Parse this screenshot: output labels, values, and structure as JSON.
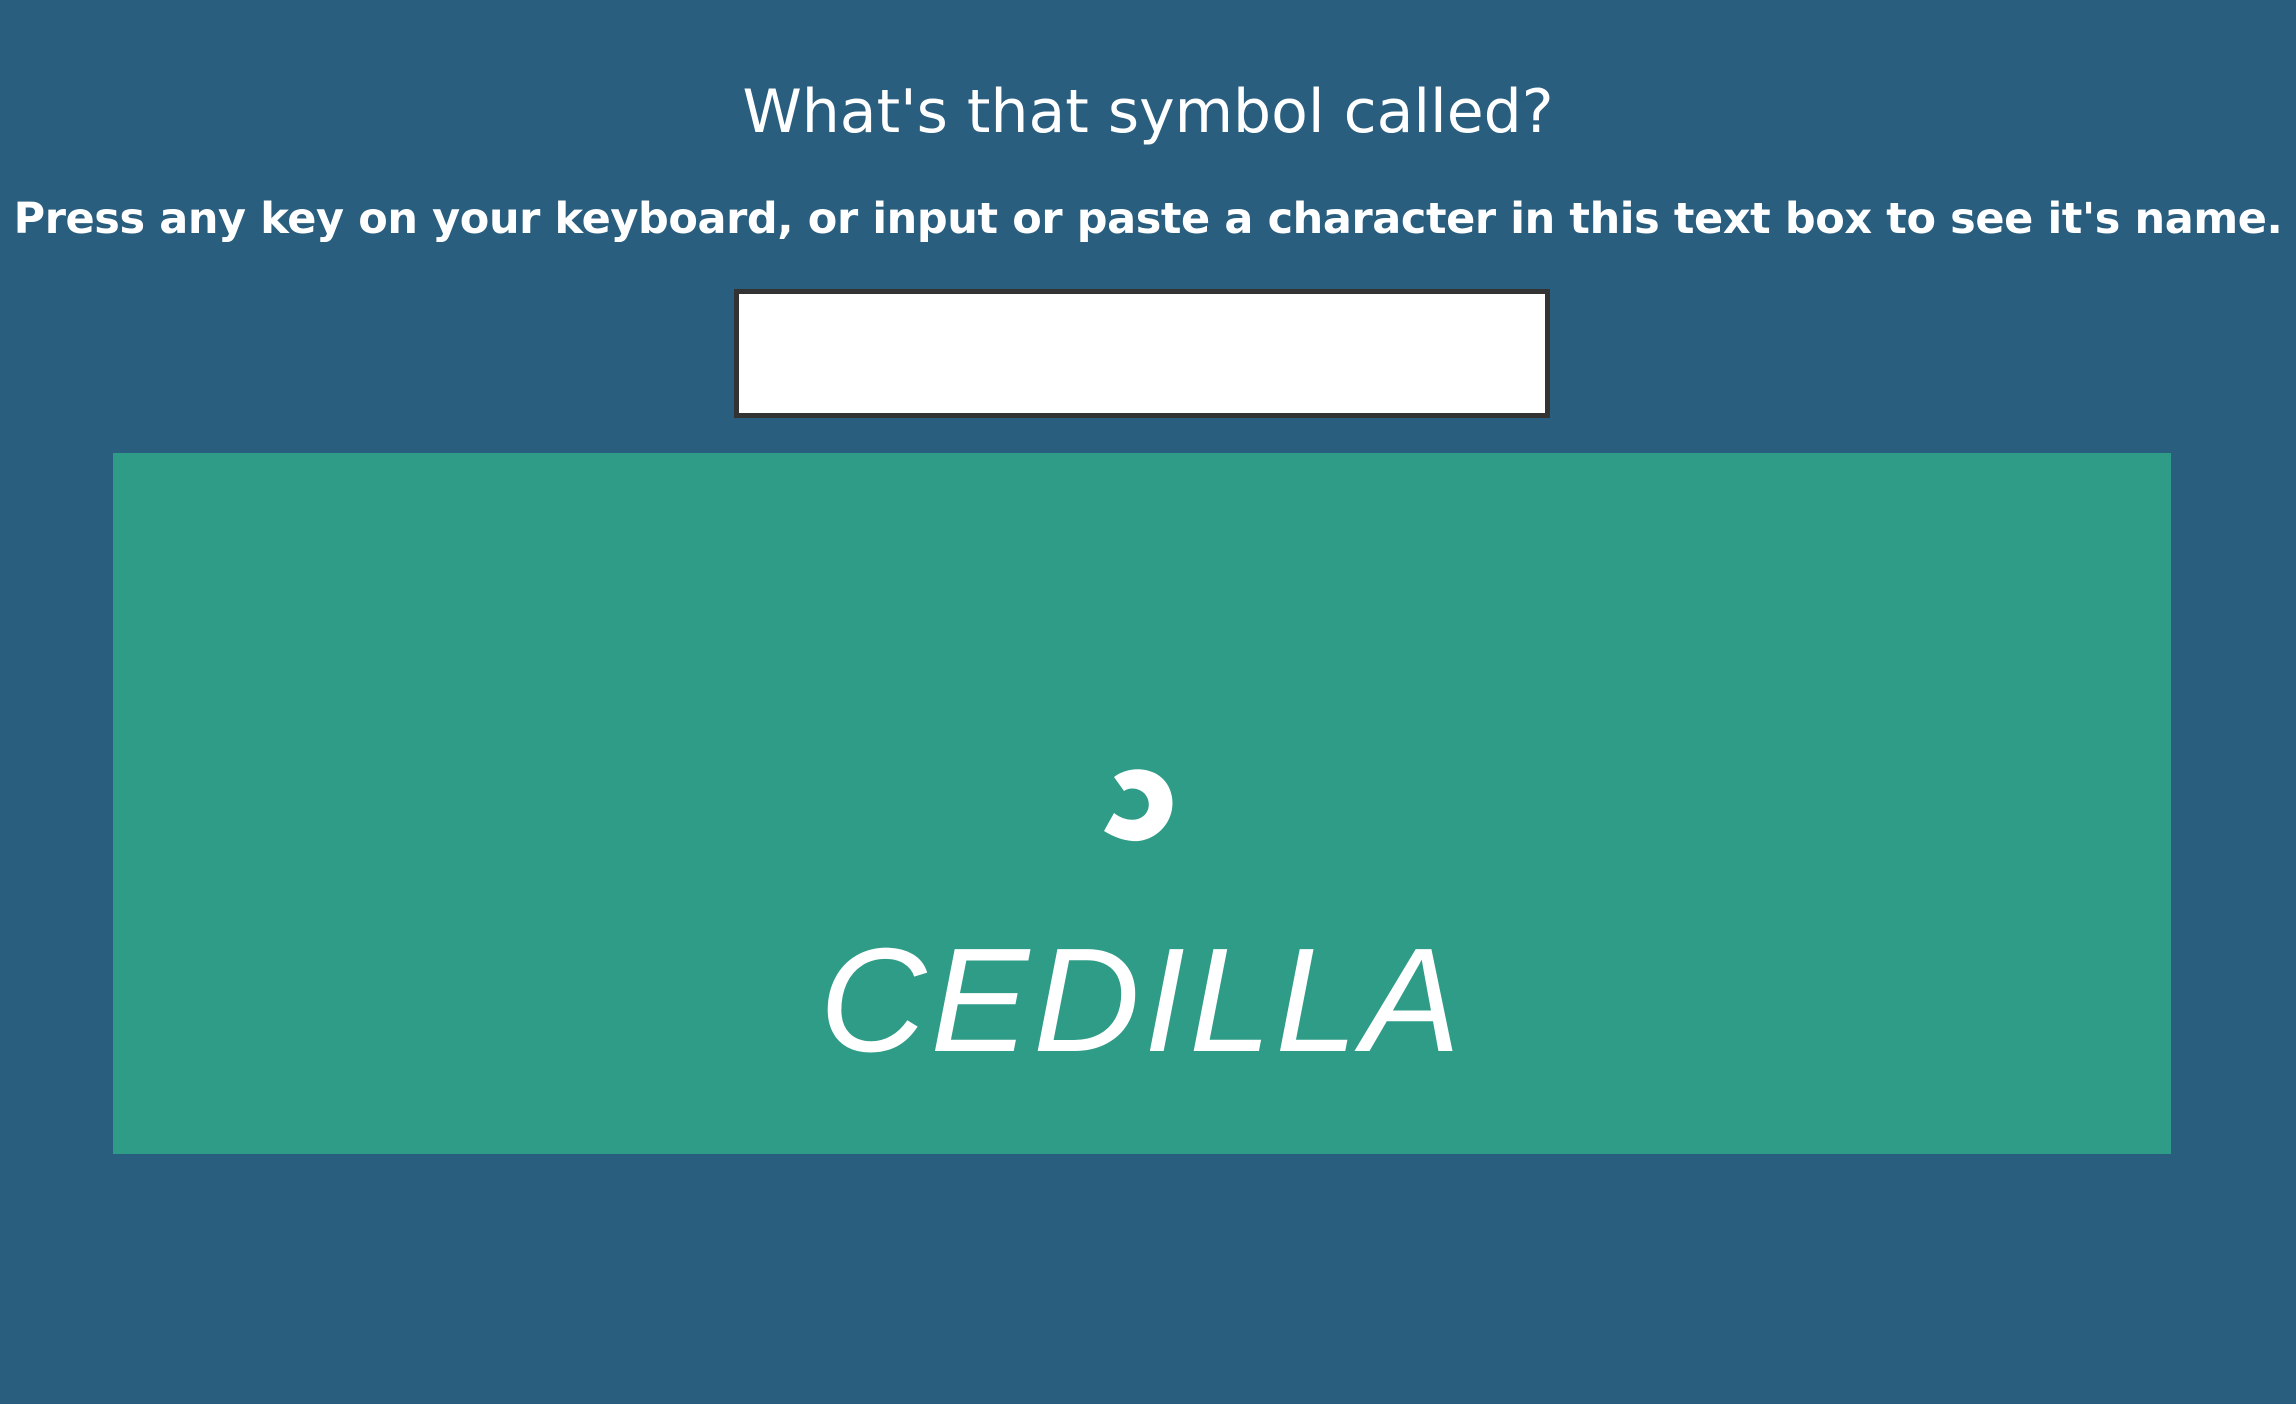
{
  "page": {
    "title": "What's that symbol called?",
    "instructions": "Press any key on your keyboard, or input or paste a character in this text box to see it's name."
  },
  "input": {
    "value": "",
    "placeholder": ""
  },
  "result": {
    "symbol_icon": "cedilla-glyph",
    "name": "CEDILLA"
  },
  "colors": {
    "background": "#2a5e7f",
    "panel": "#2e9c86",
    "text": "#ffffff",
    "input_border": "#333333"
  }
}
